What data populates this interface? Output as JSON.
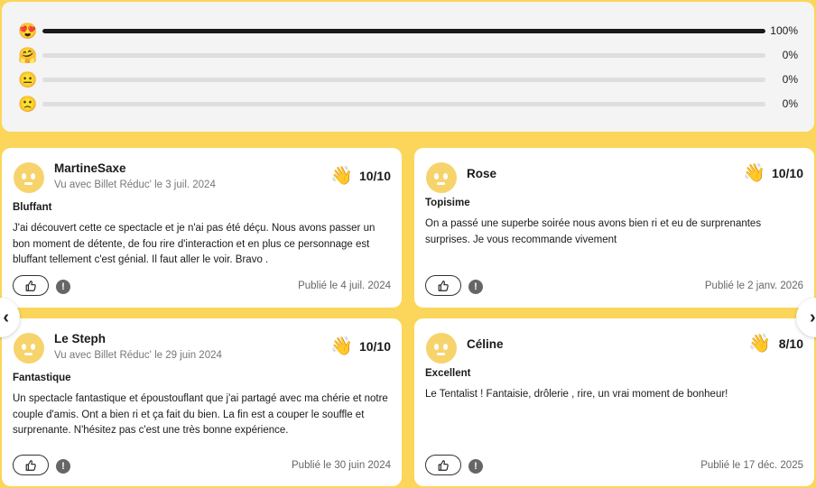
{
  "distribution": [
    {
      "emoji": "😍",
      "icon": "heart-eyes-emoji-icon",
      "percent_label": "100%",
      "fraction": 1.0
    },
    {
      "emoji": "🤗",
      "icon": "hugging-emoji-icon",
      "percent_label": "0%",
      "fraction": 0
    },
    {
      "emoji": "😐",
      "icon": "neutral-emoji-icon",
      "percent_label": "0%",
      "fraction": 0
    },
    {
      "emoji": "🙁",
      "icon": "frowning-emoji-icon",
      "percent_label": "0%",
      "fraction": 0
    }
  ],
  "reviews": [
    {
      "name": "MartineSaxe",
      "meta": "Vu avec Billet Réduc' le 3 juil. 2024",
      "score": "10/10",
      "title": "Bluffant",
      "body": "J'ai découvert cette ce spectacle et je n'ai pas été déçu. Nous avons passer un bon moment de détente, de fou rire d'interaction et en plus ce personnage est bluffant tellement c'est génial. Il faut aller le voir. Bravo .",
      "published": "Publié le 4 juil. 2024"
    },
    {
      "name": "Rose",
      "meta": "",
      "score": "10/10",
      "title": "Topisime",
      "body": "On a passé une superbe soirée nous avons bien ri et eu de surprenantes surprises. Je vous recommande vivement",
      "published": "Publié le 2 janv. 2026"
    },
    {
      "name": "Le Steph",
      "meta": "Vu avec Billet Réduc' le 29 juin 2024",
      "score": "10/10",
      "title": "Fantastique",
      "body": "Un spectacle fantastique et époustouflant que j'ai partagé avec ma chérie et notre couple d'amis. Ont a bien ri et ça fait du bien. La fin est a couper le souffle et surprenante. N'hésitez pas c'est une très bonne expérience.",
      "published": "Publié le 30 juin 2024"
    },
    {
      "name": "Céline",
      "meta": "",
      "score": "8/10",
      "title": "Excellent",
      "body": "Le Tentalist ! Fantaisie, drôlerie , rire, un vrai moment de bonheur!",
      "published": "Publié le 17 déc. 2025"
    }
  ],
  "score_icon": {
    "glyph": "👋",
    "name": "clapping-hand-icon"
  },
  "report_icon": {
    "glyph": "!",
    "name": "report-icon"
  },
  "nav": {
    "prev_glyph": "‹",
    "next_glyph": "›"
  }
}
